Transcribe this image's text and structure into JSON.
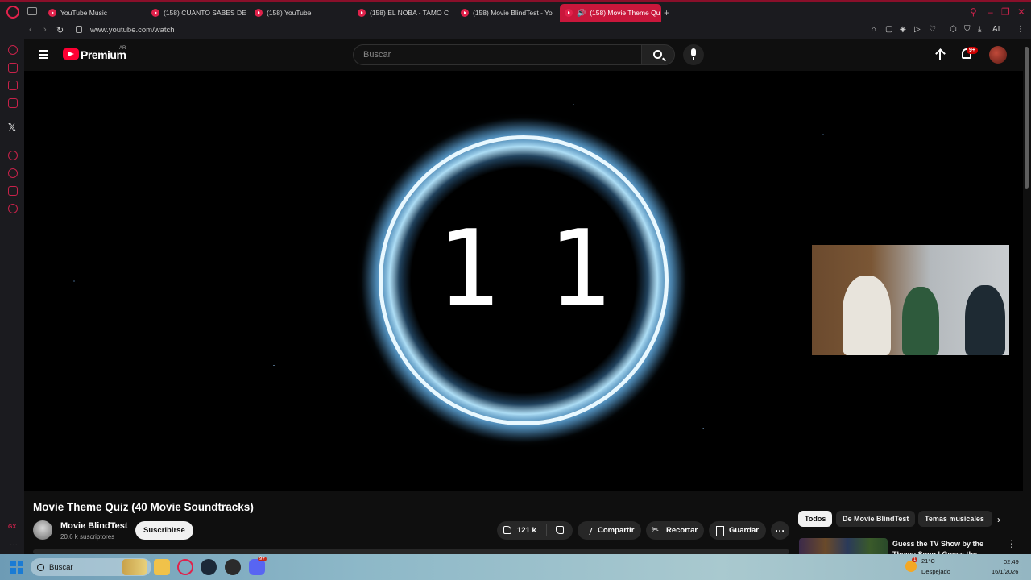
{
  "browser": {
    "tabs": [
      {
        "label": "YouTube Music",
        "active": false
      },
      {
        "label": "(158) CUANTO SABES DE",
        "active": false
      },
      {
        "label": "(158) YouTube",
        "active": false
      },
      {
        "label": "(158) EL NOBA - TAMO C",
        "active": false
      },
      {
        "label": "(158) Movie BlindTest - Yo",
        "active": false
      },
      {
        "label": "(158) Movie Theme Qu",
        "active": true
      }
    ],
    "new_tab_symbol": "+",
    "url": "www.youtube.com/watch",
    "ai_label": "AI",
    "accent_color": "#c9173b"
  },
  "youtube": {
    "logo_text": "Premium",
    "country_code": "AR",
    "search_placeholder": "Buscar",
    "notifications_badge": "9+",
    "video": {
      "countdown_text": "11",
      "title": "Movie Theme Quiz (40 Movie Soundtracks)"
    },
    "channel": {
      "name": "Movie BlindTest",
      "subscribers": "20.6 k suscriptores",
      "subscribe_label": "Suscribirse"
    },
    "actions": {
      "likes": "121 k",
      "share_label": "Compartir",
      "clip_label": "Recortar",
      "save_label": "Guardar",
      "more_label": "···"
    },
    "chips": [
      "Todos",
      "De Movie BlindTest",
      "Temas musicales"
    ],
    "recommendation": {
      "title": "Guess the TV Show by the Theme Song | Guess the Them"
    }
  },
  "taskbar": {
    "search_label": "Buscar",
    "weather_temp": "21°C",
    "weather_desc": "Despejado",
    "time": "02:49",
    "date": "16/1/2026",
    "discord_badge": "9+",
    "weather_badge": "1"
  }
}
